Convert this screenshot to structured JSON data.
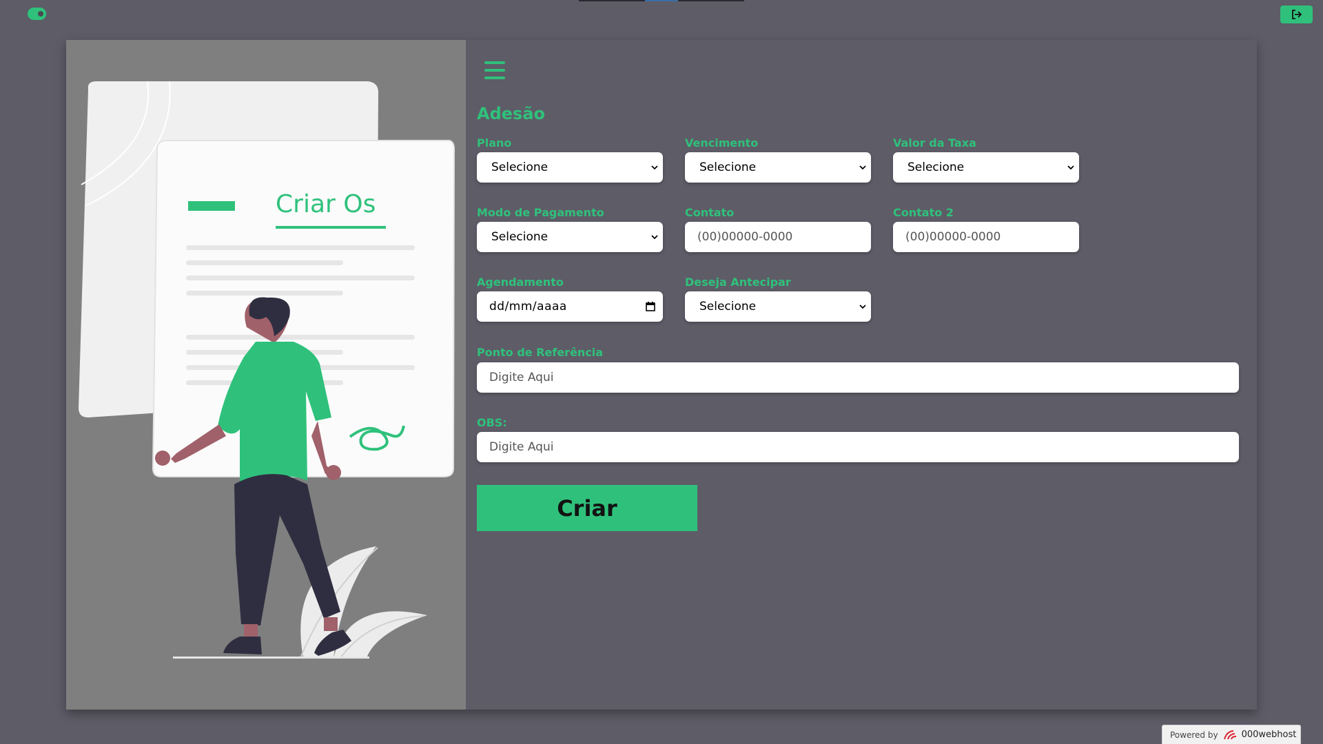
{
  "header": {
    "toggle_icon": "toggle-icon",
    "logout_icon": "logout-icon"
  },
  "illustration": {
    "title": "Criar Os"
  },
  "form": {
    "menu_icon": "hamburger-menu-icon",
    "title": "Adesão",
    "fields": {
      "plano": {
        "label": "Plano",
        "value": "Selecione"
      },
      "vencimento": {
        "label": "Vencimento",
        "value": "Selecione"
      },
      "valor_taxa": {
        "label": "Valor da Taxa",
        "value": "Selecione"
      },
      "modo_pagamento": {
        "label": "Modo de Pagamento",
        "value": "Selecione"
      },
      "contato": {
        "label": "Contato",
        "placeholder": "(00)00000-0000"
      },
      "contato2": {
        "label": "Contato 2",
        "placeholder": "(00)00000-0000"
      },
      "agendamento": {
        "label": "Agendamento",
        "value": "dd/mm/aaaa"
      },
      "deseja_antecipar": {
        "label": "Deseja Antecipar",
        "value": "Selecione"
      },
      "ponto_referencia": {
        "label": "Ponto de Referência",
        "placeholder": "Digite Aqui"
      },
      "obs": {
        "label": "OBS:",
        "placeholder": "Digite Aqui"
      }
    },
    "submit_label": "Criar"
  },
  "footer": {
    "powered_by": "Powered by",
    "brand": "000webhost"
  },
  "colors": {
    "accent": "#2fc17b",
    "background": "#5e5c67",
    "illustration_bg": "#7f7f7f"
  }
}
